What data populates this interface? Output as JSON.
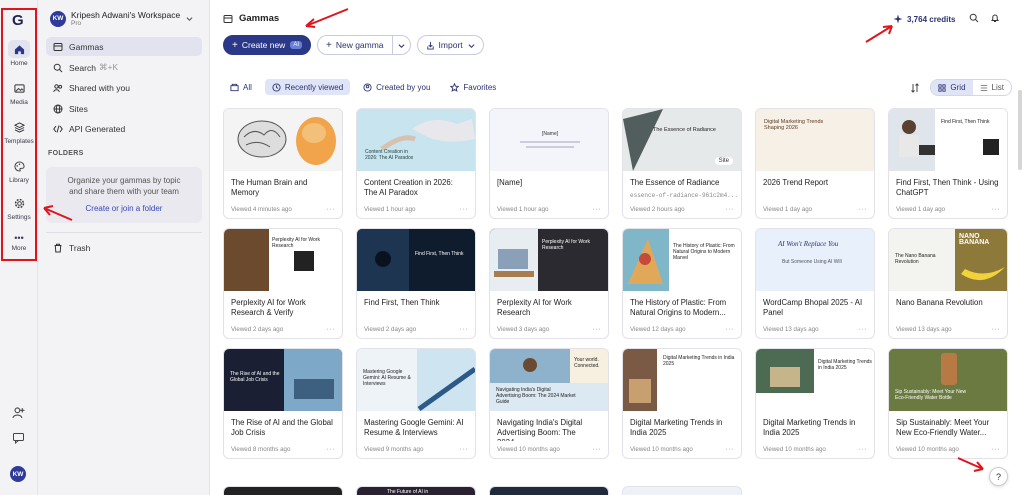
{
  "rail": {
    "items": [
      {
        "label": "Home",
        "icon": "home-icon"
      },
      {
        "label": "Media",
        "icon": "image-icon"
      },
      {
        "label": "Templates",
        "icon": "layers-icon"
      },
      {
        "label": "Library",
        "icon": "palette-icon"
      },
      {
        "label": "Settings",
        "icon": "gear-icon"
      },
      {
        "label": "More",
        "icon": "more-dots-icon"
      }
    ],
    "avatar": "KW"
  },
  "sidebar": {
    "workspace": "Kripesh Adwani's Workspace",
    "plan": "Pro",
    "avatar": "KW",
    "nav": [
      {
        "label": "Gammas",
        "icon": "gamma-icon"
      },
      {
        "label": "Search",
        "shortcut": "⌘+K",
        "icon": "search-icon"
      },
      {
        "label": "Shared with you",
        "icon": "people-icon"
      },
      {
        "label": "Sites",
        "icon": "globe-icon"
      },
      {
        "label": "API Generated",
        "icon": "code-icon"
      }
    ],
    "folders_heading": "FOLDERS",
    "folders_text": "Organize your gammas by topic and share them with your team",
    "folders_link": "Create or join a folder",
    "trash": "Trash"
  },
  "header": {
    "title": "Gammas",
    "credits": "3,764 credits"
  },
  "actions": {
    "create": "Create new",
    "ai_badge": "AI",
    "new_gamma": "New gamma",
    "import": "Import"
  },
  "filters": [
    "All",
    "Recently viewed",
    "Created by you",
    "Favorites"
  ],
  "view": {
    "grid": "Grid",
    "list": "List"
  },
  "cards": [
    {
      "title": "The Human Brain and Memory",
      "meta": "Viewed 4 minutes ago"
    },
    {
      "title": "Content Creation in 2026: The AI Paradox",
      "meta": "Viewed 1 hour ago",
      "thumb_text": "Content Creation in 2026: The AI Paradox"
    },
    {
      "title": "[Name]",
      "meta": "Viewed 1 hour ago",
      "thumb_text": "[Name]"
    },
    {
      "title": "The Essence of Radiance",
      "meta": "Viewed 2 hours ago",
      "sub": "essence-of-radiance-961c2m4...",
      "thumb_text": "The Essence of Radiance",
      "badge": "Site"
    },
    {
      "title": "2026 Trend Report",
      "meta": "Viewed 1 day ago",
      "thumb_text": "Digital Marketing Trends Shaping 2026"
    },
    {
      "title": "Find First, Then Think - Using ChatGPT",
      "meta": "Viewed 1 day ago",
      "thumb_text": "Find First, Then Think"
    },
    {
      "title": "Perplexity AI for Work Research & Verify",
      "meta": "Viewed 2 days ago",
      "thumb_text": "Perplexity AI for Work Research"
    },
    {
      "title": "Find First, Then Think",
      "meta": "Viewed 2 days ago",
      "thumb_text": "Find First, Then Think"
    },
    {
      "title": "Perplexity AI for Work Research",
      "meta": "Viewed 3 days ago",
      "thumb_text": "Perplexity AI for Work Research"
    },
    {
      "title": "The History of Plastic: From Natural Origins to Modern...",
      "meta": "Viewed 12 days ago",
      "thumb_text": "The History of Plastic: From Natural Origins to Modern Marvel"
    },
    {
      "title": "WordCamp Bhopal 2025 - AI Panel",
      "meta": "Viewed 13 days ago",
      "thumb_text": "AI Won't Replace You",
      "thumb_sub": "But Someone Using AI Will"
    },
    {
      "title": "Nano Banana Revolution",
      "meta": "Viewed 13 days ago",
      "thumb_text": "NANO BANANA",
      "thumb_sub": "The Nano Banana Revolution"
    },
    {
      "title": "The Rise of AI and the Global Job Crisis",
      "meta": "Viewed 8 months ago",
      "thumb_text": "The Rise of AI and the Global Job Crisis"
    },
    {
      "title": "Mastering Google Gemini: AI Resume & Interviews",
      "meta": "Viewed 9 months ago",
      "thumb_text": "Mastering Google Gemini: AI Resume & Interviews"
    },
    {
      "title": "Navigating India's Digital Advertising Boom: The 2024...",
      "meta": "Viewed 10 months ago",
      "thumb_text": "Navigating India's Digital Advertising Boom: The 2024 Market Guide",
      "thumb_sub": "Your world. Connected."
    },
    {
      "title": "Digital Marketing Trends in India 2025",
      "meta": "Viewed 10 months ago",
      "thumb_text": "Digital Marketing Trends in India 2025"
    },
    {
      "title": "Digital Marketing Trends in India 2025",
      "meta": "Viewed 10 months ago",
      "thumb_text": "Digital Marketing Trends in India 2025"
    },
    {
      "title": "Sip Sustainably: Meet Your New Eco-Friendly Water...",
      "meta": "Viewed 10 months ago",
      "thumb_text": "Sip Sustainably: Meet Your New Eco-Friendly Water Bottle"
    }
  ],
  "row4_thumb_text": "The Future of AI in",
  "help": "?"
}
